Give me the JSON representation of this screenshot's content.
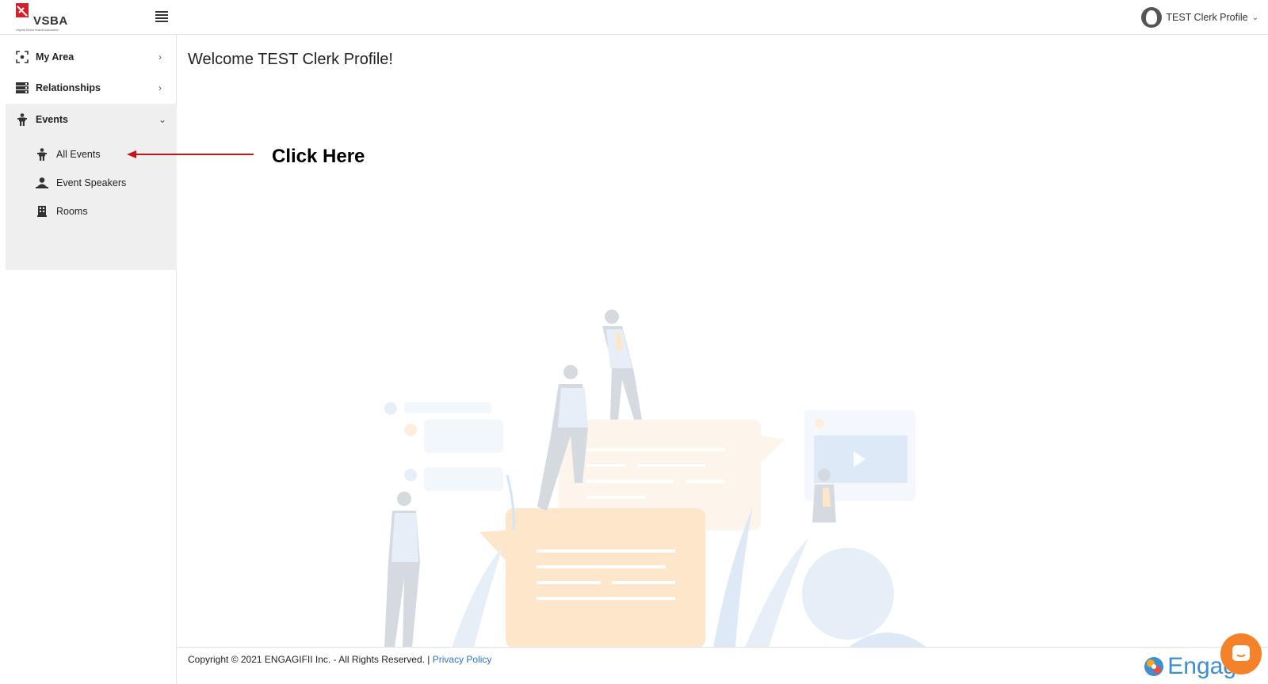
{
  "header": {
    "logo_text": "VSBA",
    "logo_sub": "Virginia School Boards Association",
    "profile_name": "TEST Clerk Profile"
  },
  "sidebar": {
    "items": [
      {
        "label": "My Area",
        "icon": "focus-icon"
      },
      {
        "label": "Relationships",
        "icon": "server-icon"
      },
      {
        "label": "Events",
        "icon": "person-icon"
      }
    ],
    "events_submenu": [
      {
        "label": "All Events",
        "icon": "person-icon"
      },
      {
        "label": "Event Speakers",
        "icon": "speaker-icon"
      },
      {
        "label": "Rooms",
        "icon": "building-icon"
      }
    ]
  },
  "main": {
    "welcome": "Welcome TEST Clerk Profile!"
  },
  "annotation": {
    "text": "Click Here",
    "color": "#c0161c"
  },
  "footer": {
    "copyright": "Copyright © 2021 ENGAGIFII Inc. - All Rights Reserved. | ",
    "privacy": "Privacy Policy",
    "brand": "Engag"
  },
  "colors": {
    "accent_blue": "#2a73c5",
    "chat_orange": "#f5812a",
    "submenu_bg": "#efefef"
  }
}
